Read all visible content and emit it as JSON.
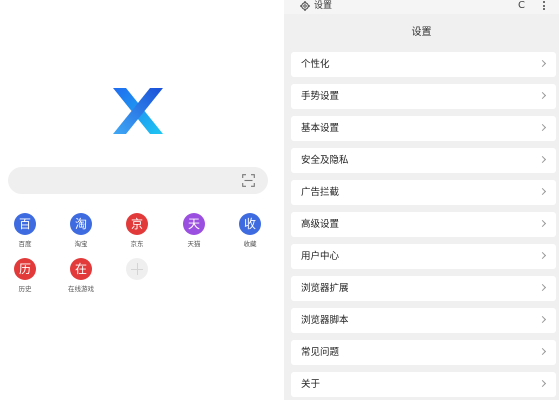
{
  "home": {
    "logo": "x-logo",
    "search": {
      "placeholder": "",
      "scan_icon": "scan-icon"
    },
    "shortcuts": [
      {
        "label": "百度",
        "glyph": "百",
        "color": "#3e6be0"
      },
      {
        "label": "淘宝",
        "glyph": "淘",
        "color": "#3e6be0"
      },
      {
        "label": "京东",
        "glyph": "京",
        "color": "#e23a3a"
      },
      {
        "label": "天猫",
        "glyph": "天",
        "color": "#9b4fe0"
      },
      {
        "label": "收藏",
        "glyph": "收",
        "color": "#3e6be0"
      },
      {
        "label": "历史",
        "glyph": "历",
        "color": "#e23a3a"
      },
      {
        "label": "在线游戏",
        "glyph": "在",
        "color": "#e23a3a"
      }
    ],
    "add_shortcut_icon": "plus-icon"
  },
  "settings": {
    "status_title": "设置",
    "refresh_glyph": "C",
    "page_title": "设置",
    "items": [
      {
        "label": "个性化"
      },
      {
        "label": "手势设置"
      },
      {
        "label": "基本设置"
      },
      {
        "label": "安全及隐私"
      },
      {
        "label": "广告拦截"
      },
      {
        "label": "高级设置"
      },
      {
        "label": "用户中心"
      },
      {
        "label": "浏览器扩展"
      },
      {
        "label": "浏览器脚本"
      },
      {
        "label": "常见问题"
      },
      {
        "label": "关于"
      }
    ]
  }
}
